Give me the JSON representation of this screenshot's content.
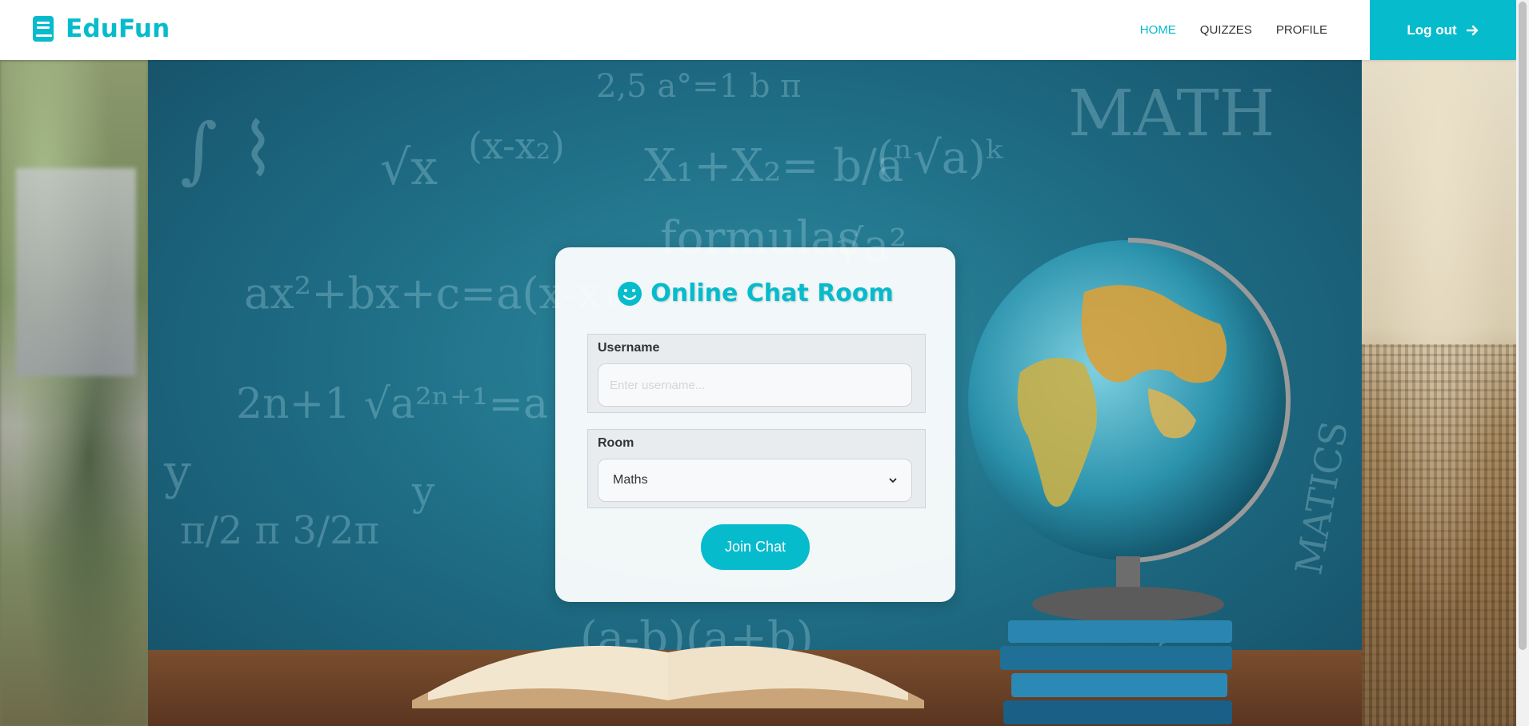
{
  "brand": {
    "name": "EduFun",
    "icon": "book-icon"
  },
  "nav": {
    "links": [
      {
        "label": "HOME",
        "active": true
      },
      {
        "label": "QUIZZES",
        "active": false
      },
      {
        "label": "PROFILE",
        "active": false
      }
    ],
    "logout_label": "Log out",
    "logout_icon": "arrow-right-icon"
  },
  "chat": {
    "title": "Online Chat Room",
    "title_icon": "smile-icon",
    "username_label": "Username",
    "username_placeholder": "Enter username...",
    "username_value": "",
    "room_label": "Room",
    "room_selected": "Maths",
    "join_label": "Join Chat"
  },
  "colors": {
    "accent": "#06BBCC",
    "nav_text": "#333333"
  }
}
